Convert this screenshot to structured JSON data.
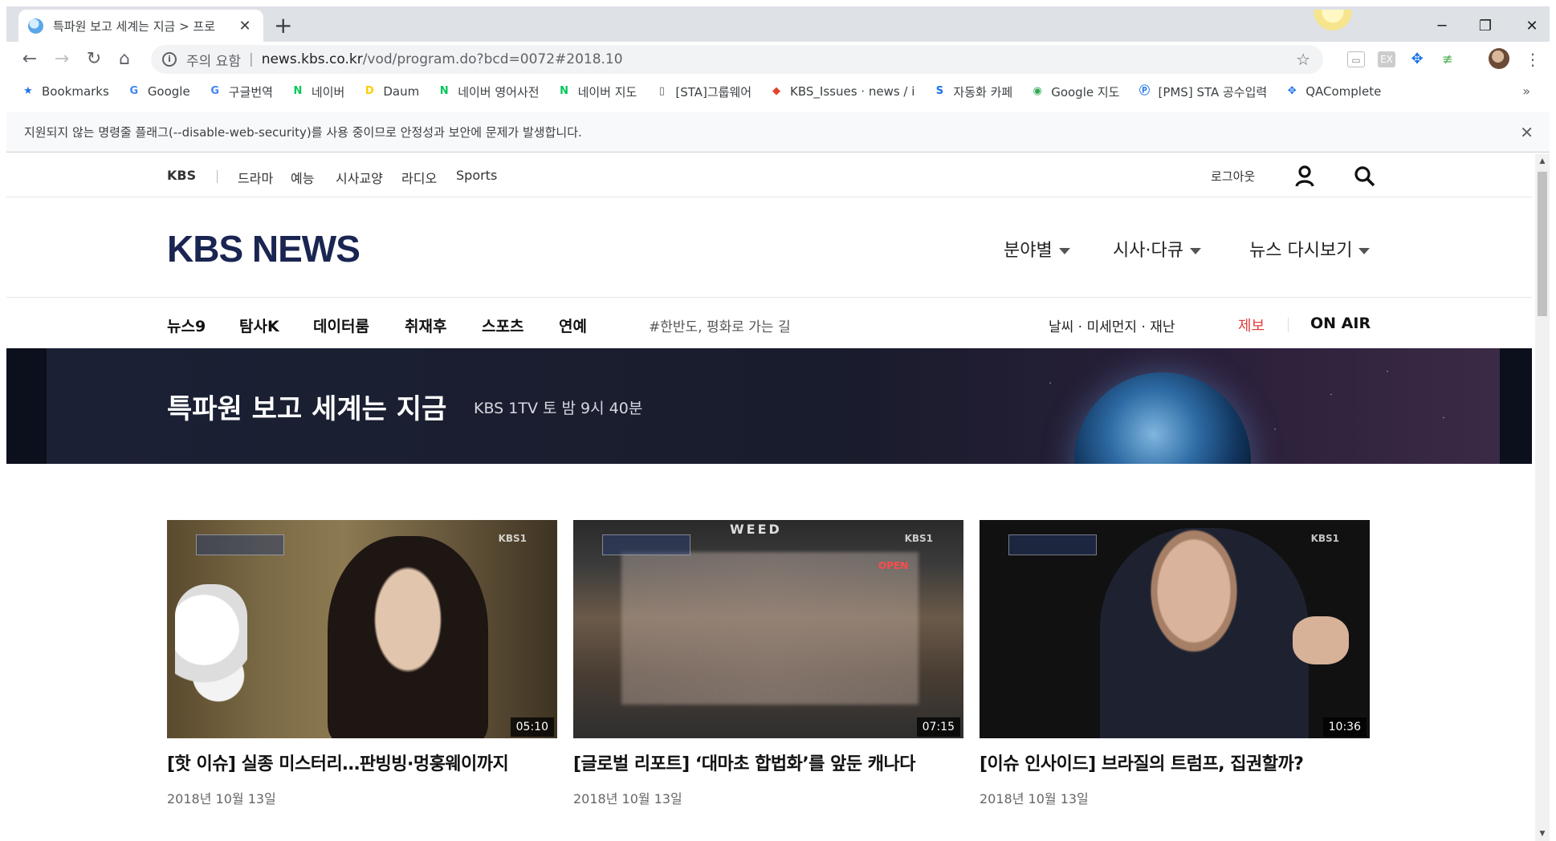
{
  "browser": {
    "tab_title": "특파원 보고 세계는 지금 > 프로",
    "address_warning": "주의 요함",
    "address_host": "news.kbs.co.kr",
    "address_path": "/vod/program.do?bcd=0072#2018.10",
    "bookmarks": [
      {
        "label": "Bookmarks",
        "icon": "star-icon",
        "color": "#1a73e8"
      },
      {
        "label": "Google",
        "icon": "google-icon",
        "color": "#4285f4"
      },
      {
        "label": "구글번역",
        "icon": "translate-icon",
        "color": "#4285f4"
      },
      {
        "label": "네이버",
        "icon": "naver-icon",
        "color": "#03c75a"
      },
      {
        "label": "Daum",
        "icon": "daum-icon",
        "color": "#ffcd00"
      },
      {
        "label": "네이버 영어사전",
        "icon": "dict-icon",
        "color": "#03c75a"
      },
      {
        "label": "네이버 지도",
        "icon": "naver-icon",
        "color": "#03c75a"
      },
      {
        "label": "[STA]그룹웨어",
        "icon": "page-icon",
        "color": "#5f6368"
      },
      {
        "label": "KBS_Issues · news / i",
        "icon": "gitlab-icon",
        "color": "#e24329"
      },
      {
        "label": "자동화 카페",
        "icon": "stc-icon",
        "color": "#1a73e8"
      },
      {
        "label": "Google 지도",
        "icon": "maps-icon",
        "color": "#34a853"
      },
      {
        "label": "[PMS] STA 공수입력",
        "icon": "pms-icon",
        "color": "#1a73e8"
      },
      {
        "label": "QAComplete",
        "icon": "qacomplete-icon",
        "color": "#1a73e8"
      }
    ],
    "bookmarks_more": "»",
    "infobar_text": "지원되지 않는 명령줄 플래그(--disable-web-security)를 사용 중이므로 안정성과 보안에 문제가 발생합니다."
  },
  "gnb": {
    "brand": "KBS",
    "links": [
      "드라마",
      "예능",
      "시사교양",
      "라디오",
      "Sports"
    ],
    "logout": "로그아웃"
  },
  "header": {
    "logo": "KBS NEWS",
    "menus": [
      "분야별",
      "시사·다큐",
      "뉴스 다시보기"
    ]
  },
  "lnb": {
    "items": [
      "뉴스9",
      "탐사K",
      "데이터룸",
      "취재후",
      "스포츠",
      "연예"
    ],
    "hashtag": "#한반도, 평화로 가는 길",
    "weather": "날씨 · 미세먼지 · 재난",
    "report": "제보",
    "onair": "ON AIR"
  },
  "banner": {
    "title": "특파원 보고 세계는 지금",
    "schedule": "KBS 1TV 토 밤 9시 40분"
  },
  "videos": [
    {
      "title": "[핫 이슈] 실종 미스터리…판빙빙·멍훙웨이까지",
      "date": "2018년 10월 13일",
      "duration": "05:10",
      "channel": "KBS1"
    },
    {
      "title": "[글로벌 리포트] ‘대마초 합법화’를 앞둔 캐나다",
      "date": "2018년 10월 13일",
      "duration": "07:15",
      "channel": "KBS1",
      "sign": "WEED",
      "open_sign": "OPEN"
    },
    {
      "title": "[이슈 인사이드] 브라질의 트럼프, 집권할까?",
      "date": "2018년 10월 13일",
      "duration": "10:36",
      "channel": "KBS1"
    }
  ]
}
